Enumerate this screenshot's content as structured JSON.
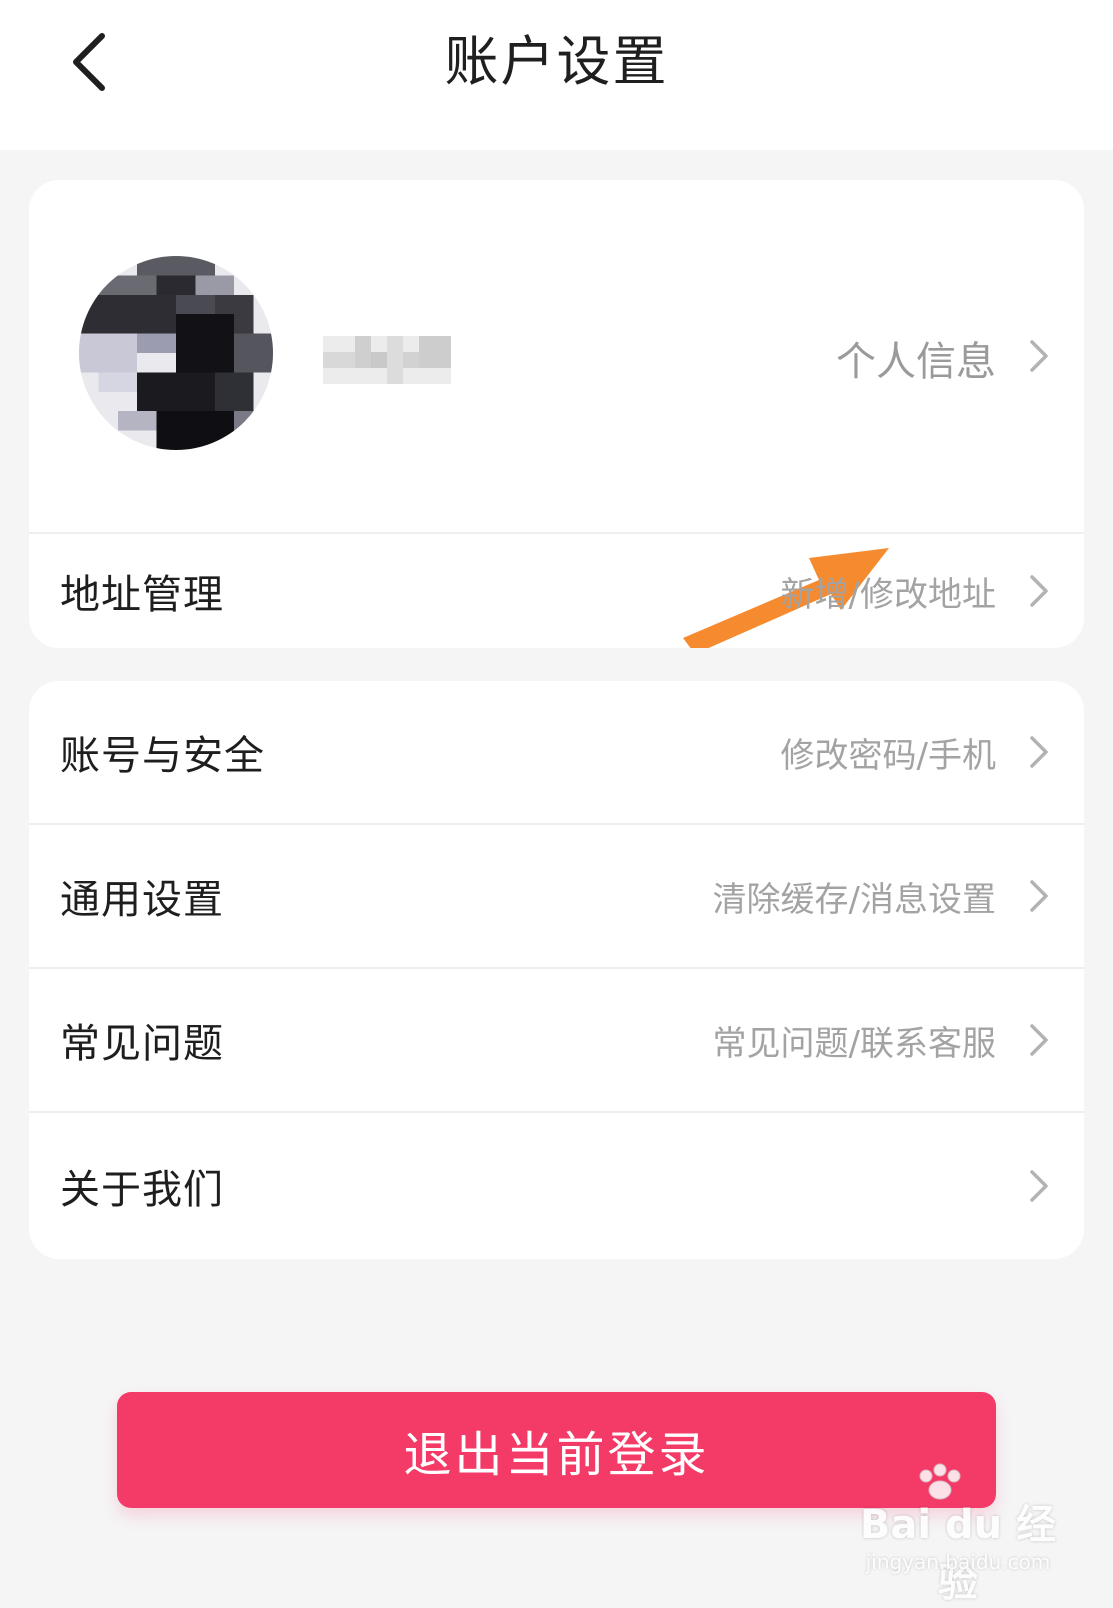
{
  "header": {
    "title": "账户设置",
    "back_icon": "chevron-left-icon"
  },
  "profile": {
    "avatar": "pixelated-avatar",
    "username": "",
    "hint": "个人信息"
  },
  "card1_rows": [
    {
      "label": "地址管理",
      "hint": "新增/修改地址"
    }
  ],
  "card2_rows": [
    {
      "label": "账号与安全",
      "hint": "修改密码/手机"
    },
    {
      "label": "通用设置",
      "hint": "清除缓存/消息设置"
    },
    {
      "label": "常见问题",
      "hint": "常见问题/联系客服"
    },
    {
      "label": "关于我们",
      "hint": ""
    }
  ],
  "logout": {
    "label": "退出当前登录"
  },
  "watermark": {
    "brand": "Bai du 经验",
    "url": "jingyan.baidu.com"
  },
  "colors": {
    "accent": "#f43b68",
    "annotation_arrow": "#f58b2e",
    "background": "#f5f5f6",
    "hint_text": "#a3a3a3"
  }
}
